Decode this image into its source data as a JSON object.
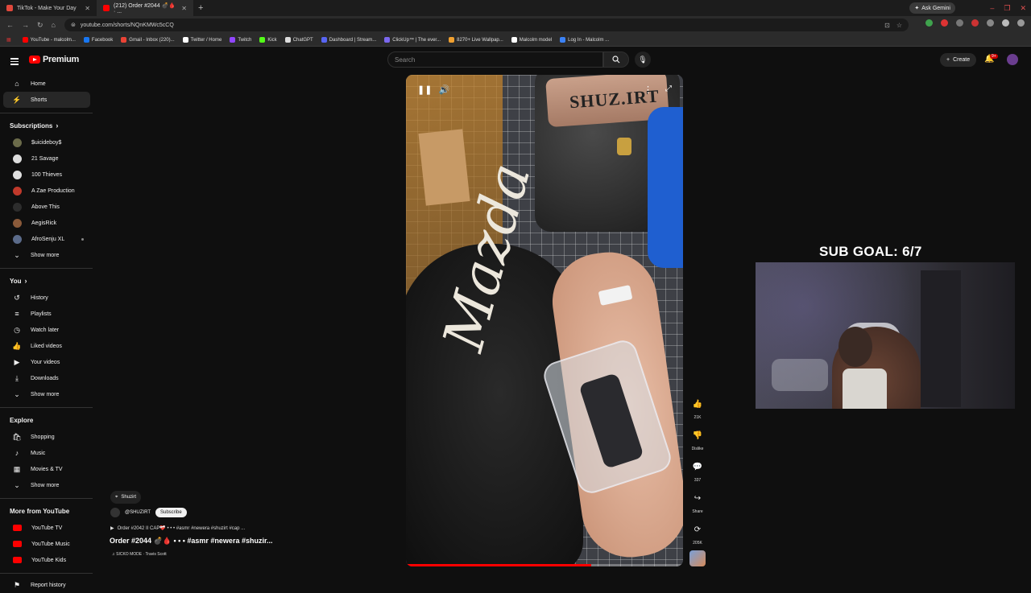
{
  "browser": {
    "tabs": [
      {
        "title": "TikTok - Make Your Day",
        "active": false,
        "favicon_color": "#e0483c"
      },
      {
        "title": "(212) Order #2044 💣🩸 · ...",
        "active": true,
        "favicon_color": "#ff0000"
      }
    ],
    "ask_gemini": "Ask Gemini",
    "url": "youtube.com/shorts/NQnKMWc5cCQ",
    "bookmarks": [
      {
        "label": "YouTube - malcolm...",
        "color": "#ff0000"
      },
      {
        "label": "Facebook",
        "color": "#1877f2"
      },
      {
        "label": "Gmail - Inbox (220)...",
        "color": "#ea4335"
      },
      {
        "label": "Twitter / Home",
        "color": "#ffffff"
      },
      {
        "label": "Twitch",
        "color": "#9146ff"
      },
      {
        "label": "Kick",
        "color": "#53fc18"
      },
      {
        "label": "ChatGPT",
        "color": "#dddddd"
      },
      {
        "label": "Dashboard | Stream...",
        "color": "#5865f2"
      },
      {
        "label": "ClickUp™ | The ever...",
        "color": "#7b68ee"
      },
      {
        "label": "8270+ Live Wallpap...",
        "color": "#f0a030"
      },
      {
        "label": "Malcolm model",
        "color": "#ffffff"
      },
      {
        "label": "Log In - Malcolm ...",
        "color": "#3b82f6"
      }
    ]
  },
  "header": {
    "logo_text": "Premium",
    "search_placeholder": "Search",
    "create_label": "Create",
    "notif_badge": "9+"
  },
  "sidebar": {
    "main": [
      {
        "label": "Home",
        "icon": "home-icon",
        "glyph": "⌂",
        "active": false
      },
      {
        "label": "Shorts",
        "icon": "shorts-icon",
        "glyph": "⚡",
        "active": true
      }
    ],
    "subscriptions_heading": "Subscriptions",
    "subscriptions": [
      {
        "label": "$uicideboy$",
        "color": "#6b6b4a"
      },
      {
        "label": "21 Savage",
        "color": "#dddddd"
      },
      {
        "label": "100 Thieves",
        "color": "#e0e0e0"
      },
      {
        "label": "A Zae Production",
        "color": "#c0392b"
      },
      {
        "label": "Above This",
        "color": "#2d2d2d"
      },
      {
        "label": "AegisRick",
        "color": "#8a5a3a"
      },
      {
        "label": "AfroSenju XL",
        "color": "#5b6b8a"
      }
    ],
    "show_more": "Show more",
    "you_heading": "You",
    "you_items": [
      {
        "label": "History",
        "glyph": "↺",
        "icon": "history-icon"
      },
      {
        "label": "Playlists",
        "glyph": "≡",
        "icon": "playlists-icon"
      },
      {
        "label": "Watch later",
        "glyph": "◷",
        "icon": "watch-later-icon"
      },
      {
        "label": "Liked videos",
        "glyph": "👍",
        "icon": "liked-icon"
      },
      {
        "label": "Your videos",
        "glyph": "▶",
        "icon": "your-videos-icon"
      },
      {
        "label": "Downloads",
        "glyph": "⤓",
        "icon": "downloads-icon"
      }
    ],
    "explore_heading": "Explore",
    "explore_items": [
      {
        "label": "Shopping",
        "glyph": "🛍",
        "icon": "shopping-icon"
      },
      {
        "label": "Music",
        "glyph": "♪",
        "icon": "music-icon"
      },
      {
        "label": "Movies & TV",
        "glyph": "▦",
        "icon": "movies-icon"
      }
    ],
    "more_heading": "More from YouTube",
    "more_items": [
      {
        "label": "YouTube TV"
      },
      {
        "label": "YouTube Music"
      },
      {
        "label": "YouTube Kids"
      }
    ],
    "report": "Report history"
  },
  "video": {
    "machine_text": "SHUZ.IRT",
    "cap_text": "Mazda",
    "progress": 0.67,
    "location": "Shuzirt",
    "channel": "@SHUZIRT",
    "subscribe": "Subscribe",
    "description": "Order #2042 II CAP❤️‍🩹 • • • #asmr #newera #shuzirt #cap ...",
    "title": "Order #2044 💣🩸 • • • #asmr #newera #shuzir...",
    "sound": "SICKO MODE · Travis Scott"
  },
  "actions": {
    "like_count": "21K",
    "dislike_label": "Dislike",
    "comment_count": "337",
    "share_label": "Share",
    "remix_count": "205K"
  },
  "overlay": {
    "sub_goal": "SUB GOAL: 6/7"
  }
}
